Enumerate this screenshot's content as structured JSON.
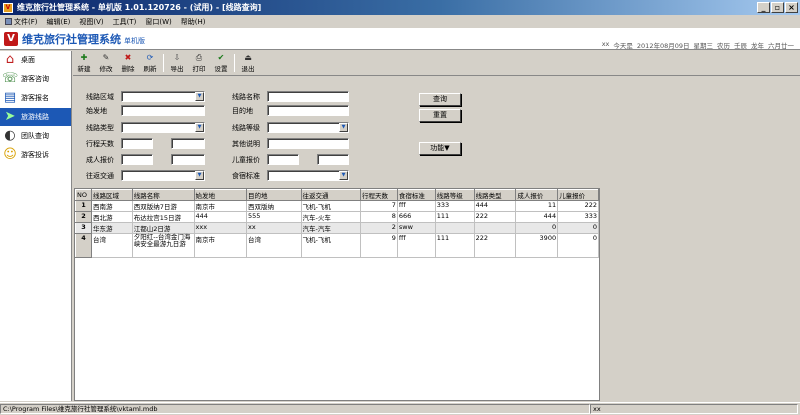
{
  "window": {
    "title": "维克旅行社管理系统 - 单机版 1.01.120726 - (试用) - [线路查询]",
    "icon": "app-icon",
    "minimize": "_",
    "restore": "▫",
    "close": "×"
  },
  "menu": [
    "文件(F)",
    "编辑(E)",
    "视图(V)",
    "工具(T)",
    "窗口(W)",
    "帮助(H)"
  ],
  "banner": {
    "logo": "V",
    "title": "维克旅行社管理系统",
    "edition": "单机版"
  },
  "datebar": [
    "xx",
    "今天是",
    "2012年08月09日",
    "星期三",
    "农历",
    "壬辰",
    "龙年",
    "六月廿一"
  ],
  "sidebar": [
    {
      "label": "桌面",
      "icon": "house-icon",
      "glyph": "⌂",
      "color": "#c02020"
    },
    {
      "label": "游客咨询",
      "icon": "consult-icon",
      "glyph": "☏",
      "color": "#2a7a2a"
    },
    {
      "label": "游客报名",
      "icon": "register-icon",
      "glyph": "▤",
      "color": "#1c58b5"
    },
    {
      "label": "旅游线路",
      "icon": "route-icon",
      "glyph": "➤",
      "color": "#2a9a2a"
    },
    {
      "label": "团队查询",
      "icon": "team-icon",
      "glyph": "◐",
      "color": "#333"
    },
    {
      "label": "游客投诉",
      "icon": "smiley-icon",
      "glyph": "☺",
      "color": "#d8a000"
    }
  ],
  "toolbar": [
    {
      "label": "新建",
      "icon": "new-icon",
      "glyph": "✚",
      "color": "#1a7a1a"
    },
    {
      "label": "修改",
      "icon": "edit-icon",
      "glyph": "✎",
      "color": "#333"
    },
    {
      "label": "删除",
      "icon": "delete-icon",
      "glyph": "✖",
      "color": "#c01818"
    },
    {
      "label": "刷新",
      "icon": "refresh-icon",
      "glyph": "⟳",
      "color": "#1c58b5"
    },
    {
      "label": "导出",
      "icon": "export-icon",
      "glyph": "⇩",
      "color": "#555"
    },
    {
      "label": "打印",
      "icon": "print-icon",
      "glyph": "⎙",
      "color": "#333"
    },
    {
      "label": "设置",
      "icon": "settings-icon",
      "glyph": "✔",
      "color": "#1a7a1a"
    },
    {
      "label": "退出",
      "icon": "exit-icon",
      "glyph": "⏏",
      "color": "#333"
    }
  ],
  "form": {
    "route_region_label": "线路区域",
    "route_region_value": "",
    "route_name_label": "线路名称",
    "route_name_value": "",
    "departure_label": "始发地",
    "departure_value": "",
    "destination_label": "目的地",
    "destination_value": "",
    "route_type_label": "线路类型",
    "route_type_value": "",
    "route_grade_label": "线路等级",
    "route_grade_value": "",
    "travel_days_label": "行程天数",
    "travel_days_from": "",
    "travel_days_to": "",
    "other_notes_label": "其他说明",
    "other_notes_value": "",
    "adult_price_label": "成人报价",
    "adult_price_from": "",
    "adult_price_to": "",
    "child_price_label": "儿童报价",
    "child_price_from": "",
    "child_price_to": "",
    "transport_label": "往返交通",
    "transport_value": "",
    "lodging_label": "食宿标准",
    "lodging_value": "",
    "query_button": "查询",
    "reset_button": "重置",
    "function_button": "功能▼"
  },
  "grid": {
    "columns": [
      "NO",
      "线路区域",
      "线路名称",
      "始发地",
      "目的地",
      "往返交通",
      "行程天数",
      "食宿标准",
      "线路等级",
      "线路类型",
      "成人报价",
      "儿童报价"
    ],
    "rows": [
      [
        "1",
        "西南游",
        "西双版纳7日游",
        "南京市",
        "西双版纳",
        "飞机-飞机",
        "7",
        "fff",
        "333",
        "444",
        "11",
        "222"
      ],
      [
        "2",
        "西北游",
        "布达拉宫15日游",
        "444",
        "555",
        "汽车-火车",
        "8",
        "666",
        "111",
        "222",
        "444",
        "333"
      ],
      [
        "3",
        "华东游",
        "江都山2日游",
        "xxx",
        "xx",
        "汽车-汽车",
        "2",
        "sww",
        "",
        "",
        "0",
        "0"
      ],
      [
        "4",
        "台湾",
        "夕阳红--台湾金门海峡安全最游九日游",
        "南京市",
        "台湾",
        "飞机-飞机",
        "9",
        "fff",
        "111",
        "222",
        "3900",
        "0"
      ]
    ]
  },
  "statusbar": {
    "path": "C:\\Program Files\\维克旅行社管理系统\\vktaml.mdb",
    "pane2": "xx"
  }
}
